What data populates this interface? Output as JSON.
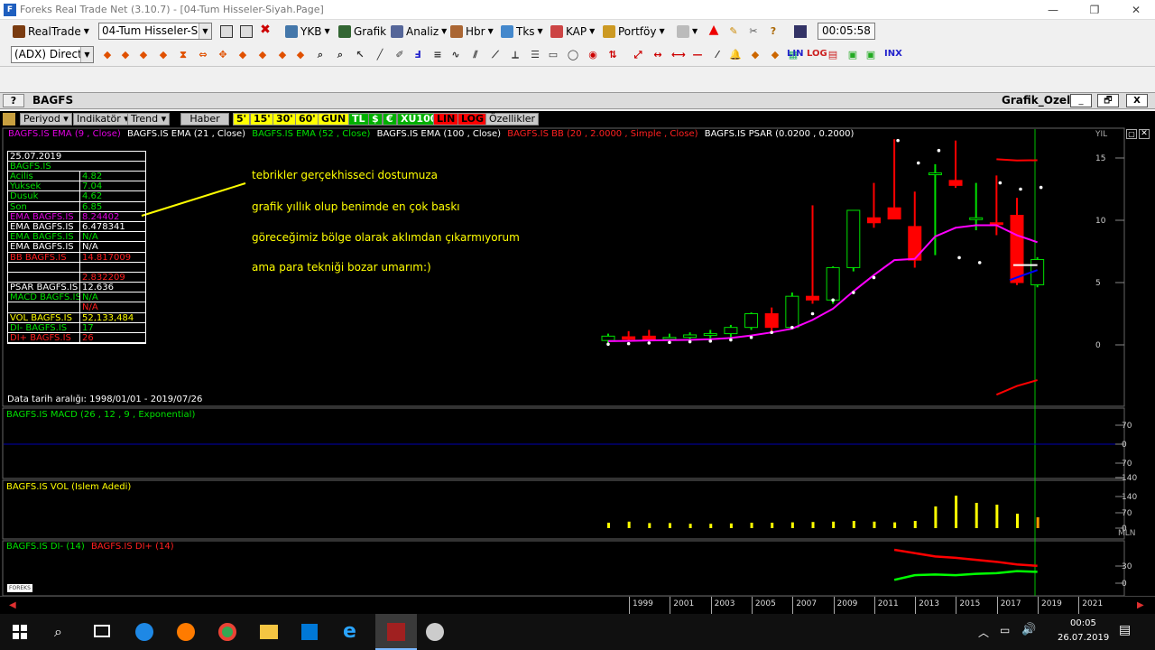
{
  "window": {
    "title": "Foreks Real Trade Net (3.10.7) - [04-Tum Hisseler-Siyah.Page]",
    "clock": "00:05:58"
  },
  "toolbar1": {
    "realtrade": "RealTrade",
    "page_combo": "04-Tum Hisseler-Siyal",
    "ykb": "YKB",
    "grafik": "Grafik",
    "analiz": "Analiz",
    "hbr": "Hbr",
    "tks": "Tks",
    "kap": "KAP",
    "portfoy": "Portföy"
  },
  "toolbar2": {
    "indicator_combo": "(ADX) Directi",
    "lin": "LIN",
    "log": "LOG",
    "inx": "INX"
  },
  "subheader": {
    "help": "?",
    "symbol": "BAGFS",
    "panel": "Grafik_Ozel",
    "min": "_",
    "restore": "🗗",
    "close": "X"
  },
  "controls": {
    "periyod": "Periyod",
    "indikator": "Indikatör",
    "trend": "Trend",
    "haber": "Haber",
    "p5": "5'",
    "p15": "15'",
    "p30": "30'",
    "p60": "60'",
    "gun": "GUN",
    "tl": "TL",
    "dollar": "$",
    "euro": "€",
    "xu100": "XU100",
    "lin": "LIN",
    "log": "LOG",
    "ozellikler": "Özellikler"
  },
  "legend_main": {
    "ema9": "BAGFS.IS EMA (9 , Close)",
    "ema21": "BAGFS.IS EMA (21 , Close)",
    "ema52": "BAGFS.IS EMA (52 , Close)",
    "ema100": "BAGFS.IS EMA (100 , Close)",
    "bb": "BAGFS.IS BB (20 , 2.0000 , Simple , Close)",
    "psar": "BAGFS.IS PSAR (0.0200 , 0.2000)",
    "period_label": "YIL"
  },
  "info_table": {
    "date": "25.07.2019",
    "symbol": "BAGFS.IS",
    "rows": [
      {
        "label": "Acilis",
        "value": "4.82",
        "color": "#00e000"
      },
      {
        "label": "Yuksek",
        "value": "7.04",
        "color": "#00e000"
      },
      {
        "label": "Dusuk",
        "value": "4.62",
        "color": "#00e000"
      },
      {
        "label": "Son",
        "value": "6.85",
        "color": "#00e000"
      },
      {
        "label": "EMA BAGFS.IS",
        "value": "8.24402",
        "color": "#e000e0"
      },
      {
        "label": "EMA BAGFS.IS",
        "value": "6.478341",
        "color": "#ffffff"
      },
      {
        "label": "EMA BAGFS.IS",
        "value": "N/A",
        "color": "#00e000"
      },
      {
        "label": "EMA BAGFS.IS",
        "value": "N/A",
        "color": "#ffffff"
      },
      {
        "label": "BB BAGFS.IS",
        "value": "14.817009",
        "color": "#ff2020"
      },
      {
        "label": "",
        "value": "",
        "color": "#0000ff"
      },
      {
        "label": "",
        "value": "2.832209",
        "color": "#ff2020"
      },
      {
        "label": "PSAR BAGFS.IS",
        "value": "12.636",
        "color": "#ffffff"
      },
      {
        "label": "MACD BAGFS.IS",
        "value": "N/A",
        "color": "#00e000"
      },
      {
        "label": "",
        "value": "N/A",
        "color": "#ff2020"
      },
      {
        "label": "VOL BAGFS.IS",
        "value": "52,133,484",
        "color": "#ffff00"
      },
      {
        "label": "DI- BAGFS.IS",
        "value": "17",
        "color": "#00e000"
      },
      {
        "label": "DI+ BAGFS.IS",
        "value": "26",
        "color": "#ff2020"
      }
    ]
  },
  "annotation": {
    "lines": [
      "tebrikler gerçekhisseci dostumuza",
      "grafik yıllık olup benimde en çok baskı",
      "göreceğimiz bölge olarak  aklımdan çıkarmıyorum",
      "ama para tekniği bozar umarım:)"
    ]
  },
  "date_range": "Data tarih aralığı: 1998/01/01 - 2019/07/26",
  "macd_legend": "BAGFS.IS MACD (26 , 12 , 9 , Exponential)",
  "vol_legend": "BAGFS.IS VOL (Islem Adedi)",
  "vol_unit": "MLN",
  "di_legend_minus": "BAGFS.IS DI- (14)",
  "di_legend_plus": "BAGFS.IS DI+ (14)",
  "chart_data": {
    "type": "candlestick",
    "x": [
      "1998",
      "1999",
      "2000",
      "2001",
      "2002",
      "2003",
      "2004",
      "2005",
      "2006",
      "2007",
      "2008",
      "2009",
      "2010",
      "2011",
      "2012",
      "2013",
      "2014",
      "2015",
      "2016",
      "2017",
      "2018",
      "2019"
    ],
    "open": [
      0.35,
      0.65,
      0.7,
      0.5,
      0.6,
      0.8,
      0.9,
      1.4,
      2.5,
      1.4,
      3.9,
      3.6,
      6.2,
      10.2,
      11.0,
      9.5,
      13.7,
      13.2,
      10.2,
      9.8,
      10.4,
      4.82
    ],
    "high": [
      0.9,
      1.1,
      1.2,
      0.9,
      1.0,
      1.2,
      1.6,
      2.6,
      3.0,
      4.2,
      11.2,
      6.3,
      10.8,
      13.0,
      16.5,
      12.3,
      14.5,
      16.4,
      13.0,
      13.6,
      11.8,
      7.04
    ],
    "low": [
      0.1,
      0.3,
      0.4,
      0.2,
      0.2,
      0.4,
      0.6,
      1.2,
      1.1,
      1.3,
      3.3,
      3.3,
      5.9,
      9.4,
      10.1,
      6.2,
      7.2,
      12.6,
      9.2,
      8.8,
      4.8,
      4.62
    ],
    "close": [
      0.7,
      0.45,
      0.35,
      0.6,
      0.8,
      0.9,
      1.4,
      2.5,
      1.4,
      3.9,
      3.6,
      6.2,
      10.8,
      9.8,
      10.1,
      6.8,
      13.8,
      12.8,
      10.2,
      9.7,
      5.0,
      6.85
    ],
    "ema": [
      0.3,
      0.32,
      0.35,
      0.38,
      0.4,
      0.45,
      0.55,
      0.75,
      1.0,
      1.3,
      2.0,
      2.9,
      4.3,
      5.6,
      6.8,
      6.9,
      8.7,
      9.4,
      9.6,
      9.6,
      8.8,
      8.24
    ],
    "psar": [
      0.05,
      0.1,
      0.15,
      0.2,
      0.25,
      0.3,
      0.4,
      0.6,
      1.0,
      1.4,
      2.5,
      3.6,
      4.2,
      5.4,
      16.4,
      14.6,
      15.6,
      7.0,
      6.6,
      13.0,
      12.5,
      12.64
    ],
    "bb_upper": [
      null,
      null,
      null,
      null,
      null,
      null,
      null,
      null,
      null,
      null,
      null,
      null,
      null,
      null,
      null,
      null,
      null,
      null,
      null,
      14.9,
      14.8,
      14.82
    ],
    "bb_lower": [
      null,
      null,
      null,
      null,
      null,
      null,
      null,
      null,
      null,
      null,
      null,
      null,
      null,
      null,
      null,
      null,
      null,
      null,
      null,
      -4.0,
      -3.3,
      -2.83
    ],
    "volume": [
      15,
      18,
      14,
      14,
      12,
      12,
      13,
      15,
      15,
      16,
      17,
      18,
      20,
      18,
      16,
      20,
      60,
      90,
      70,
      65,
      40,
      30
    ],
    "di_minus": [
      null,
      null,
      null,
      null,
      null,
      null,
      null,
      null,
      null,
      null,
      null,
      null,
      null,
      null,
      5,
      12,
      13,
      12,
      14,
      15,
      18,
      17
    ],
    "di_plus": [
      null,
      null,
      null,
      null,
      null,
      null,
      null,
      null,
      null,
      null,
      null,
      null,
      null,
      null,
      50,
      45,
      40,
      38,
      35,
      32,
      28,
      26
    ],
    "y_ticks": [
      0,
      5,
      10,
      15
    ],
    "macd_ticks": [
      "70",
      "0",
      "70",
      "140"
    ],
    "vol_ticks": [
      "140",
      "70",
      "0"
    ],
    "di_ticks": [
      "30",
      "0"
    ],
    "year_labels": [
      "1999",
      "2001",
      "2003",
      "2005",
      "2007",
      "2009",
      "2011",
      "2013",
      "2015",
      "2017",
      "2019",
      "2021"
    ]
  },
  "taskbar": {
    "time": "00:05",
    "date": "26.07.2019"
  }
}
